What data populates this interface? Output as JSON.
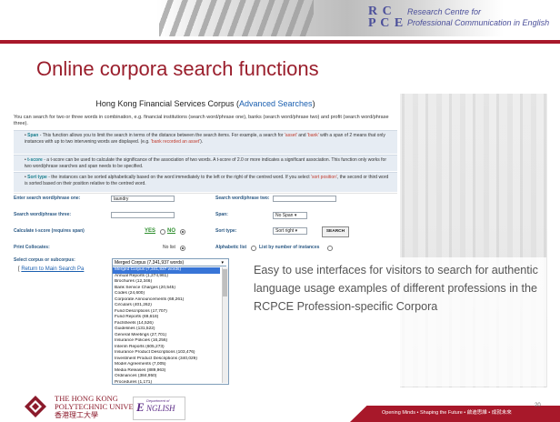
{
  "header": {
    "logo_mark_line1": "R C",
    "logo_mark_line2": "P C E",
    "centre_name_line1": "Research Centre for",
    "centre_name_line2": "Professional Communication in English"
  },
  "slide_title": "Online corpora search functions",
  "corpus_page": {
    "title_main": "Hong Kong Financial Services Corpus (",
    "title_link": "Advanced Searches",
    "title_end": ")",
    "intro": "You can search for two or three words in combination, e.g. financial institutions (search word/phrase one), banks (search word/phrase two) and profit (search word/phrase three).",
    "span_head": "Span",
    "span_text": " - This function allows you to limit the search in terms of the distance between the search items. For example, a search for ",
    "span_q1": "'asset'",
    "span_text2": " and ",
    "span_q2": "'bank'",
    "span_text3": " with a span of 2 means that only instances with up to two intervening words are displayed. (e.g. ",
    "span_q3": "'bank recorded an asset'",
    "span_text4": ").",
    "tscore_head": "t-score",
    "tscore_text": " - a t-score can be used to calculate the significance of the association of two words. A t-score of 2.0 or more indicates a significant association. This function only works for two word/phrase searches and span needs to be specified.",
    "sort_head": "Sort type",
    "sort_text": " - the instances can be sorted alphabetically based on the word immediately to the left or the right of the centred word. If you select ",
    "sort_q": "'sort position'",
    "sort_text2": ", the second or third word is sorted based on their position relative to the centred word.",
    "labels": {
      "word_one": "Enter search word/phrase one:",
      "word_two": "Search word/phrase two:",
      "word_three": "Search word/phrase three:",
      "span": "Span:",
      "tscore": "Calculate t-score (requires span)",
      "sort_type": "Sort type:",
      "print_collocates": "Print Collocates:",
      "alphabetic_list": "Alphabetic list",
      "list_by_number": "List by number of instances",
      "select_corpus": "Select corpus or subcorpus:"
    },
    "values": {
      "word_one": "laundry",
      "span": "No Span",
      "yes": "YES",
      "no": "NO",
      "sort_type": "Sort right",
      "no_list": "No list",
      "corpus_selected": "Merged Corpus (7,341,937 words)"
    },
    "search_button": "SEARCH",
    "return_prefix": "[ ",
    "return_link": "Return to Main Search Pa",
    "dropdown_items": [
      "Merged Corpus (7,341,937 words)",
      "Annual Reports (1,274,961)",
      "Brochures (12,346)",
      "Bank Service Charges (20,545)",
      "Codes (24,600)",
      "Corporate Announcements (68,261)",
      "Circulars (401,262)",
      "Fund Descriptions (17,707)",
      "Fund Reports (69,618)",
      "Factsheets (14,526)",
      "Guidelines (131,522)",
      "General Meetings (27,701)",
      "Insurance Policies (16,256)",
      "Interim Reports (605,273)",
      "Insurance Product Descriptions (103,476)",
      "Investment Product Descriptions (340,029)",
      "Model Agreements (7,005)",
      "Media Releases (889,963)",
      "Ordinances (384,950)",
      "Procedures (1,171)"
    ]
  },
  "callout": "Easy to use interfaces for visitors to search for authentic language usage examples of different professions in the RCPCE Profession-specific Corpora",
  "footer": {
    "polyu_line1": "THE HONG KONG",
    "polyu_line2": "POLYTECHNIC UNIVERSITY",
    "polyu_line3": "香港理工大學",
    "english_dept": "Department of",
    "english_logo": "NGLISH",
    "tagline": "Opening Minds • Shaping the Future • 啟迪思維 • 成就未來",
    "page_number": "20"
  },
  "colors": {
    "brand_red": "#a8182a",
    "title_red": "#9a1e2c",
    "rcpce_blue": "#4b4f9a",
    "link_blue": "#1a5fb0"
  }
}
